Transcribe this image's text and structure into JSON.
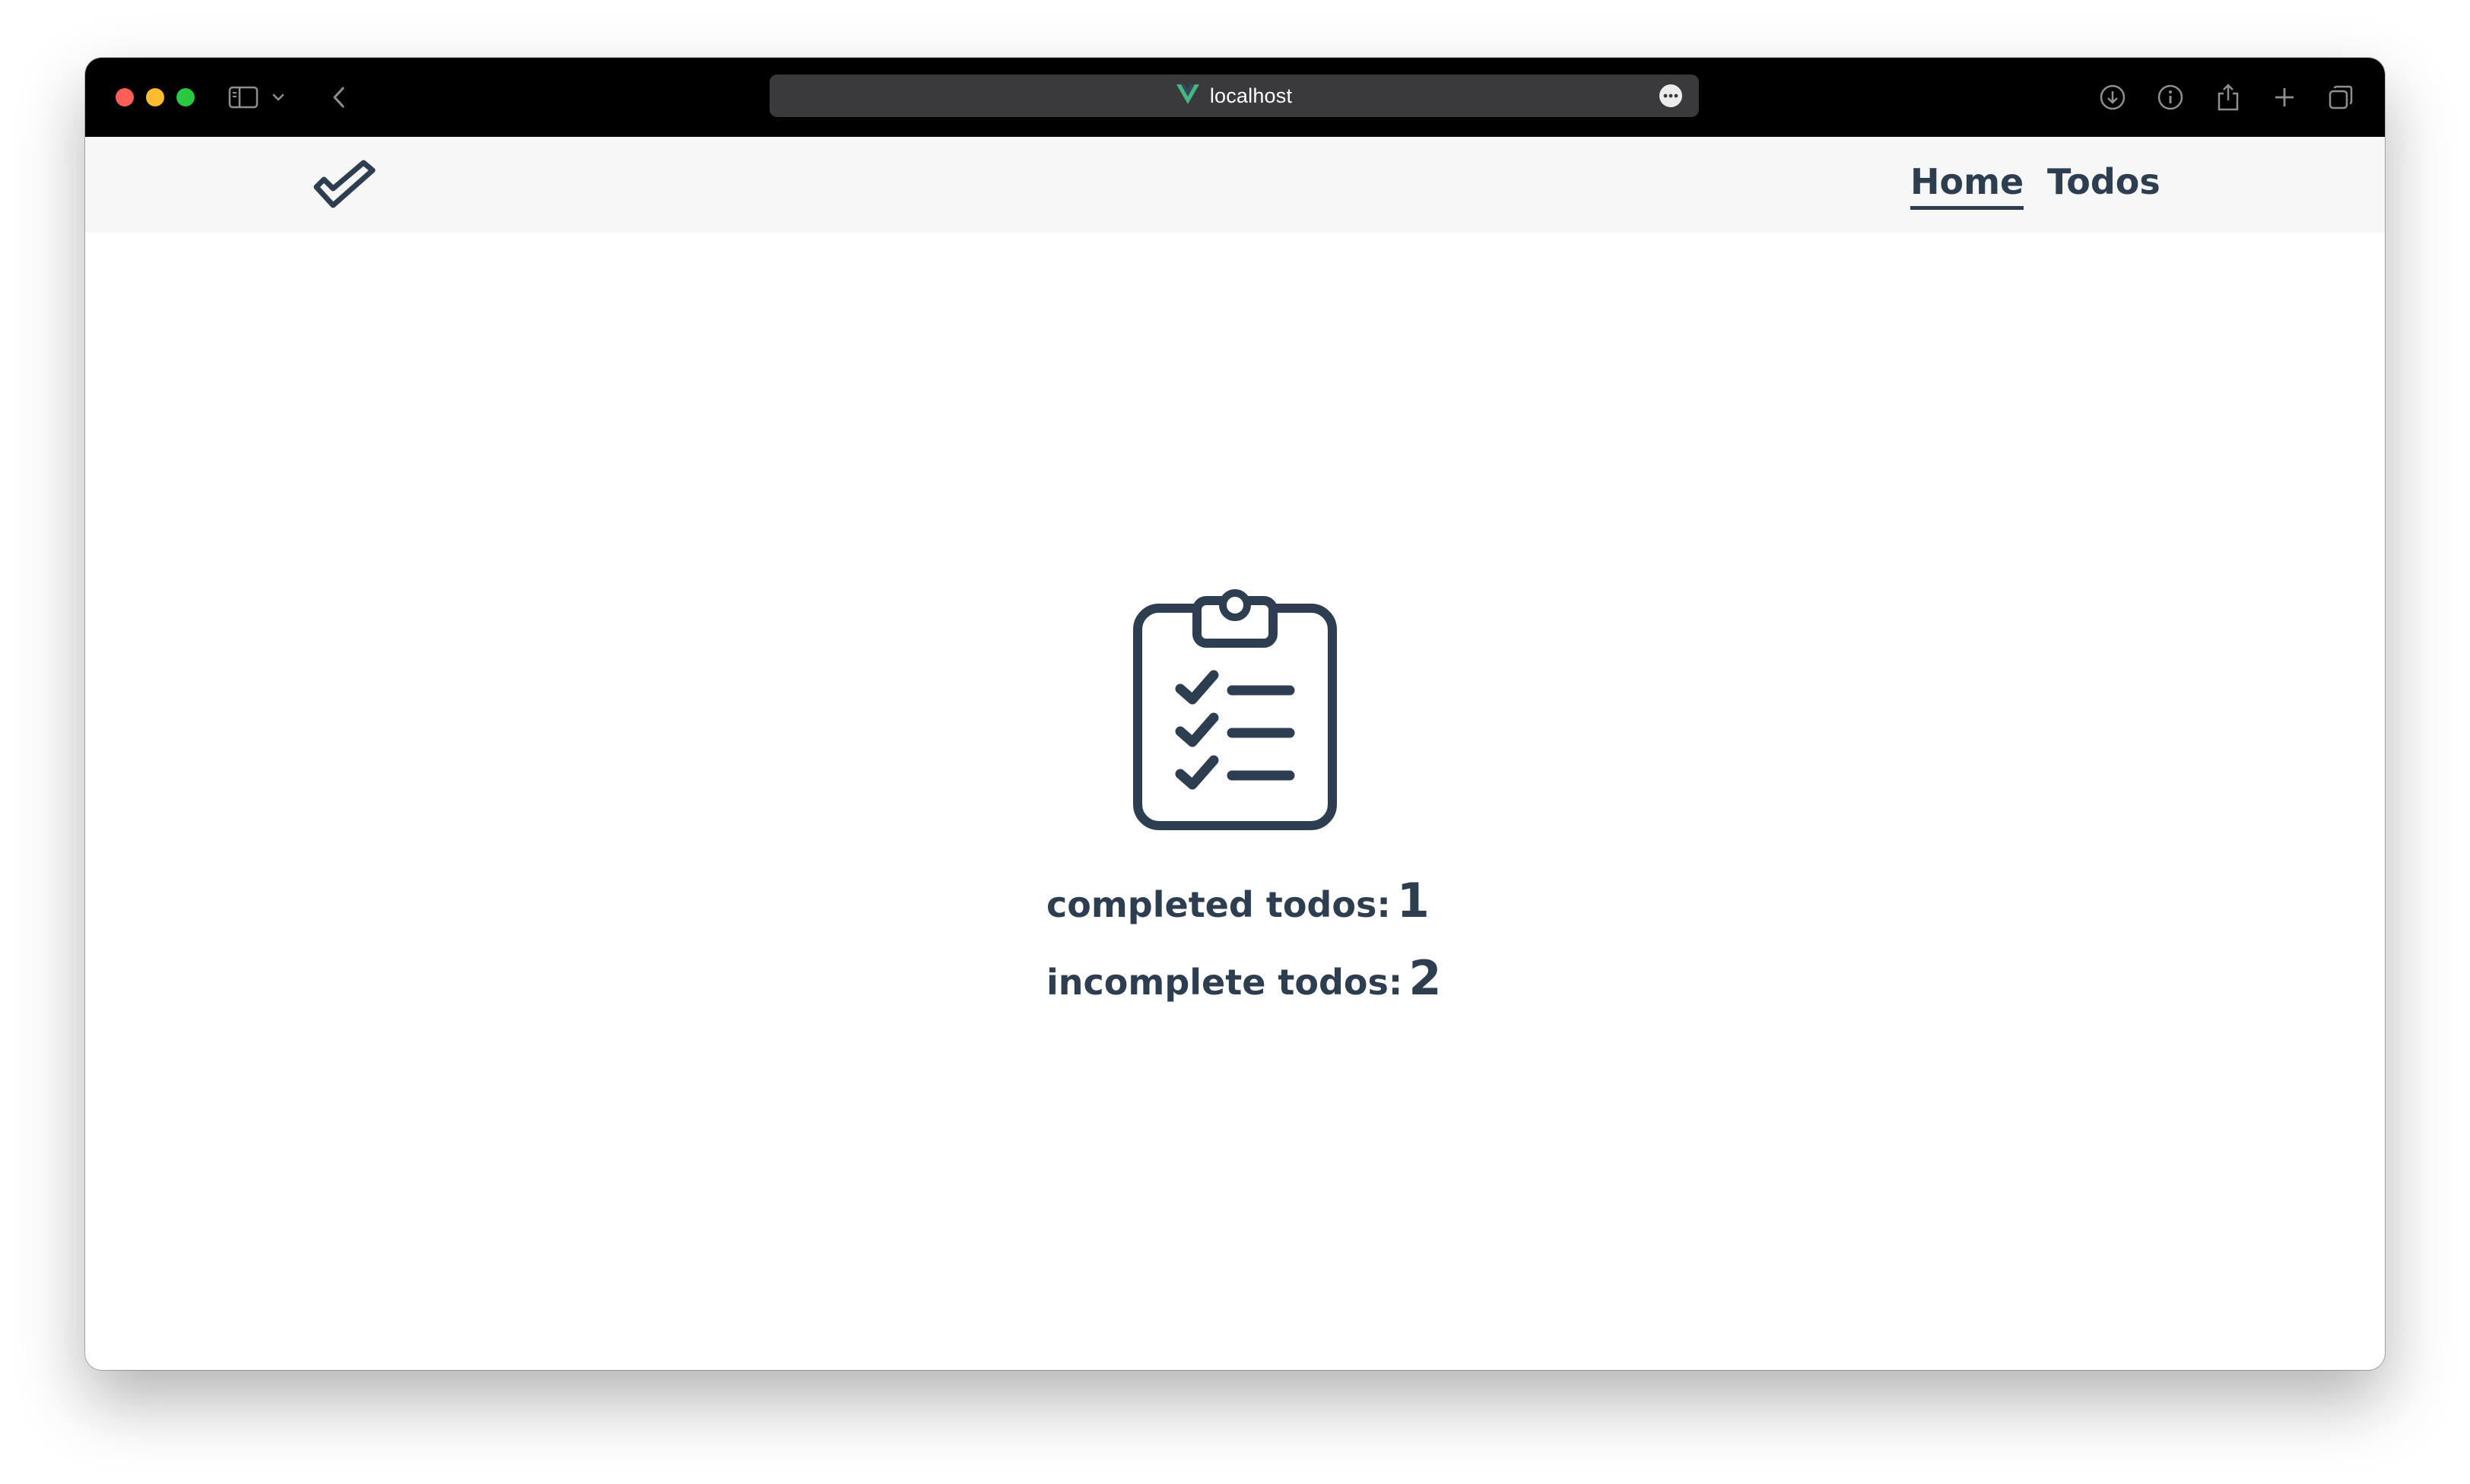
{
  "browser": {
    "address": "localhost",
    "icons": {
      "sidebar": "sidebar-icon",
      "chevron": "chevron-down-icon",
      "back": "back-arrow-icon",
      "site": "vue-logo-icon",
      "more": "more-icon",
      "download": "download-icon",
      "info": "info-icon",
      "share": "share-icon",
      "new_tab": "plus-icon",
      "tabs": "tabs-icon"
    }
  },
  "nav": {
    "logo": "double-check-icon",
    "links": [
      {
        "label": "Home",
        "active": true
      },
      {
        "label": "Todos",
        "active": false
      }
    ]
  },
  "main": {
    "icon": "clipboard-checklist-icon",
    "completed": {
      "label": "completed todos:",
      "value": "1"
    },
    "incomplete": {
      "label": "incomplete todos:",
      "value": "2"
    }
  },
  "colors": {
    "text": "#2c3e50",
    "navbar_bg": "#f7f7f7",
    "titlebar_bg": "#000000",
    "address_bg": "#3a3a3c",
    "vue_green": "#42b883"
  }
}
